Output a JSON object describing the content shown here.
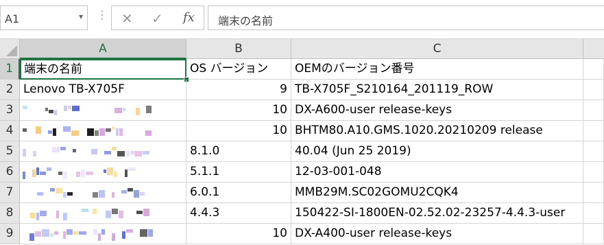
{
  "namebox": {
    "value": "A1",
    "arrow": "▾"
  },
  "formula_bar": {
    "dots": "⋮",
    "cancel_icon": "✕",
    "enter_icon": "✓",
    "fx_label": "fx",
    "content": "端末の名前"
  },
  "columns": [
    {
      "label": "A"
    },
    {
      "label": "B"
    },
    {
      "label": "C"
    },
    {
      "label": ""
    }
  ],
  "rows": [
    {
      "num": "1",
      "a": "端末の名前",
      "b": "OS バージョン",
      "b_type": "text",
      "c": "OEMのバージョン番号"
    },
    {
      "num": "2",
      "a": "Lenovo TB-X705F",
      "b": "9",
      "b_type": "num",
      "c": "TB-X705F_S210164_201119_ROW"
    },
    {
      "num": "3",
      "a": "",
      "b": "10",
      "b_type": "num",
      "c": "DX-A600-user release-keys"
    },
    {
      "num": "4",
      "a": "",
      "b": "10",
      "b_type": "num",
      "c": "BHTM80.A10.GMS.1020.20210209 release"
    },
    {
      "num": "5",
      "a": "",
      "b": "8.1.0",
      "b_type": "text",
      "c": "40.04 (Jun 25 2019)"
    },
    {
      "num": "6",
      "a": "",
      "b": "5.1.1",
      "b_type": "text",
      "c": "12-03-001-048"
    },
    {
      "num": "7",
      "a": "",
      "b": "6.0.1",
      "b_type": "text",
      "c": "MMB29M.SC02GOMU2CQK4"
    },
    {
      "num": "8",
      "a": "",
      "b": "4.4.3",
      "b_type": "text",
      "c": "150422-SI-1800EN-02.52.02-23257-4.4.3-user"
    },
    {
      "num": "9",
      "a": "",
      "b": "10",
      "b_type": "num",
      "c": "DX-A400-user release-keys"
    }
  ],
  "colors": {
    "accent": "#217346",
    "header_bg": "#e6e6e6",
    "gridline": "#d4d4d4"
  }
}
